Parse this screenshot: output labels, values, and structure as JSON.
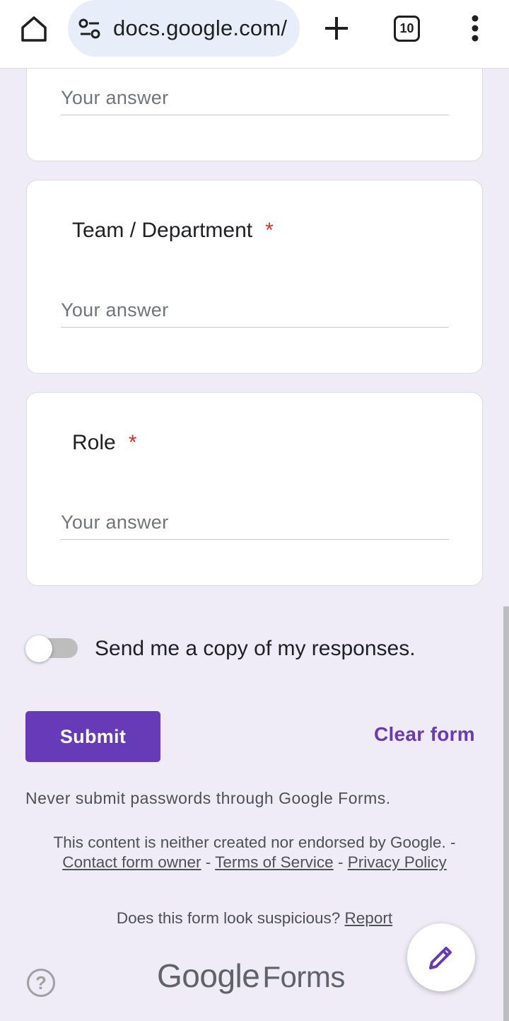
{
  "browser": {
    "url": "docs.google.com/",
    "tab_count": "10"
  },
  "form": {
    "answer_placeholder": "Your answer",
    "questions": [
      {
        "title": "Team / Department",
        "required_mark": "*"
      },
      {
        "title": "Role",
        "required_mark": "*"
      }
    ],
    "send_copy": {
      "label": "Send me a copy of my responses.",
      "enabled": false
    },
    "submit_label": "Submit",
    "clear_label": "Clear form"
  },
  "footer": {
    "warning": "Never submit passwords through Google Forms.",
    "disclaimer_prefix": "This content is neither created nor endorsed by Google. -",
    "contact_link": "Contact form owner",
    "sep1": "-",
    "terms_link": "Terms of Service",
    "sep2": "-",
    "privacy_link": "Privacy Policy",
    "suspicious_prefix": "Does this form look suspicious?",
    "report_link": "Report",
    "logo_google": "Google",
    "logo_forms": "Forms",
    "help_glyph": "?"
  },
  "colors": {
    "accent": "#673ab7",
    "background": "#efebf7",
    "required": "#d93025"
  }
}
